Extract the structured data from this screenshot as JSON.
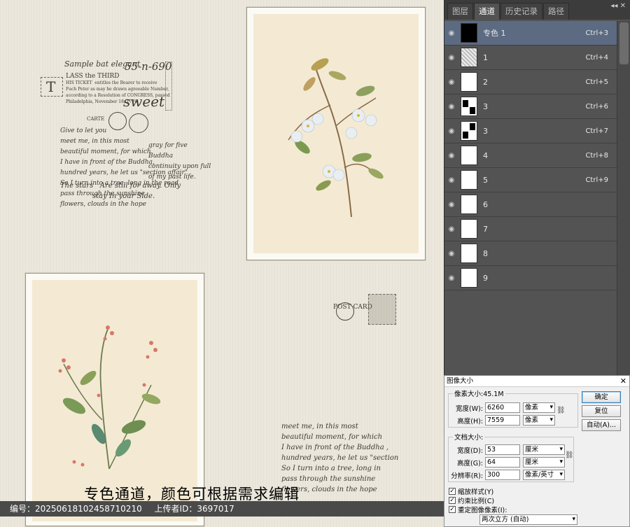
{
  "canvas": {
    "ephemera": {
      "header_script": "Sample bat elegant",
      "script_number": "55-n-690",
      "ticket_lines": [
        "LASS the THIRD",
        "HIS TICKET  entitles the Bearer to receive",
        "Fuch Peter as may be drawn agreeable Number,",
        "according to a Resolution of CONGRESS, passed",
        "Philadelphia, November 18, 1776."
      ],
      "ticket_letter": "T",
      "sweet": "sweet",
      "carte": "CARTE",
      "poem_lines": [
        "Give to let you",
        "meet me, in this most",
        "beautiful moment, for which",
        "I have in front of the Buddha,",
        "hundred years, he let us \"section affair\"",
        "So I turn into a tree, long in the road",
        "pass through the sunshine",
        "flowers, clouds in the hope"
      ],
      "poem_right": [
        "gray for five",
        "Buddha",
        "continuity upon full",
        "of my past life."
      ],
      "closing_lines": [
        "The stars   Are still for away. Only",
        "stay In your Side."
      ],
      "lower_poem_lines": [
        "meet me, in this most",
        "beautiful moment, for which",
        "I have in front of the Buddha ,",
        "hundred years, he let us \"section",
        "So I turn into a tree, long in",
        "pass through the sunshine",
        "flowers, clouds in the hope"
      ],
      "postcard_text": "POST CARD"
    },
    "caption": "专色通道，颜色可根据需求编辑",
    "footer": {
      "id_label": "编号：",
      "id_value": "20250618102458710210",
      "uploader_label": "上传者ID：",
      "uploader_value": "3697017"
    }
  },
  "panel": {
    "tabs": [
      {
        "label": "图层",
        "active": false
      },
      {
        "label": "通道",
        "active": true
      },
      {
        "label": "历史记录",
        "active": false
      },
      {
        "label": "路径",
        "active": false
      }
    ],
    "controls": "◂◂  ✕",
    "channels": [
      {
        "name": "专色 1",
        "shortcut": "Ctrl+3",
        "selected": true,
        "thumb": "black"
      },
      {
        "name": "1",
        "shortcut": "Ctrl+4",
        "selected": false,
        "thumb": "noise"
      },
      {
        "name": "2",
        "shortcut": "Ctrl+5",
        "selected": false,
        "thumb": "white"
      },
      {
        "name": "3",
        "shortcut": "Ctrl+6",
        "selected": false,
        "thumb": "blocks"
      },
      {
        "name": "3",
        "shortcut": "Ctrl+7",
        "selected": false,
        "thumb": "blocks2"
      },
      {
        "name": "4",
        "shortcut": "Ctrl+8",
        "selected": false,
        "thumb": "white"
      },
      {
        "name": "5",
        "shortcut": "Ctrl+9",
        "selected": false,
        "thumb": "white"
      },
      {
        "name": "6",
        "shortcut": "",
        "selected": false,
        "thumb": "white"
      },
      {
        "name": "7",
        "shortcut": "",
        "selected": false,
        "thumb": "white"
      },
      {
        "name": "8",
        "shortcut": "",
        "selected": false,
        "thumb": "white"
      },
      {
        "name": "9",
        "shortcut": "",
        "selected": false,
        "thumb": "white"
      }
    ]
  },
  "dialog": {
    "title": "图像大小",
    "close": "✕",
    "pixel_group": "像素大小:45.1M",
    "pixel_width_label": "宽度(W):",
    "pixel_width_value": "6260",
    "pixel_width_unit": "像素",
    "pixel_height_label": "高度(H):",
    "pixel_height_value": "7559",
    "pixel_height_unit": "像素",
    "doc_group": "文档大小:",
    "doc_width_label": "宽度(D):",
    "doc_width_value": "53",
    "doc_width_unit": "厘米",
    "doc_height_label": "高度(G):",
    "doc_height_value": "64",
    "doc_height_unit": "厘米",
    "resolution_label": "分辨率(R):",
    "resolution_value": "300",
    "resolution_unit": "像素/英寸",
    "ok_label": "确定",
    "reset_label": "复位",
    "auto_label": "自动(A)...",
    "scale_styles": "缩放样式(Y)",
    "constrain": "约束比例(C)",
    "resample": "重定图像像素(I):",
    "resample_method": "两次立方 (自动)"
  }
}
